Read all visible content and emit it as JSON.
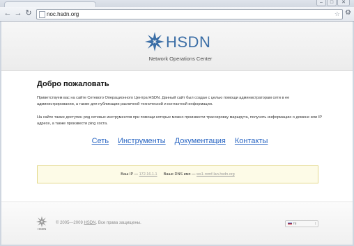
{
  "browser": {
    "url": "noc.hsdn.org",
    "window_controls": [
      "–",
      "□",
      "✕"
    ]
  },
  "header": {
    "brand": "HSDN",
    "tagline": "Network Operations Center"
  },
  "main": {
    "heading": "Добро пожаловать",
    "paragraph1": "Приветствуем вас на сайте Сетевого Операционного Центра HSDN. Данный сайт был создан с целью помощи администраторам сети в ее администрировании, а также для публикации различной технической и контактной информации.",
    "paragraph2": "На сайте также доступен ряд сетевых инструментов при помощи которых можно произвести трассировку маршрута, получить информацию о домене или IP адресе, а также произвести ping хоста.",
    "links": [
      {
        "label": "Сеть"
      },
      {
        "label": "Инструменты"
      },
      {
        "label": "Документация"
      },
      {
        "label": "Контакты"
      }
    ]
  },
  "info": {
    "ip_label": "Ваш IP —",
    "ip_value": "172.16.1.1",
    "dns_label": "Ваше DNS имя —",
    "dns_value": "ws1-romf-lan.hsdn.org"
  },
  "footer": {
    "logo_text": "HSDN",
    "copyright_prefix": "© 2005—2009",
    "org": "HSDN",
    "copyright_suffix": ". Все права защищены.",
    "language": "ru"
  },
  "colors": {
    "brand_blue": "#3b6ea6",
    "link": "#2a66c3",
    "info_bg": "#fdfbe7"
  }
}
